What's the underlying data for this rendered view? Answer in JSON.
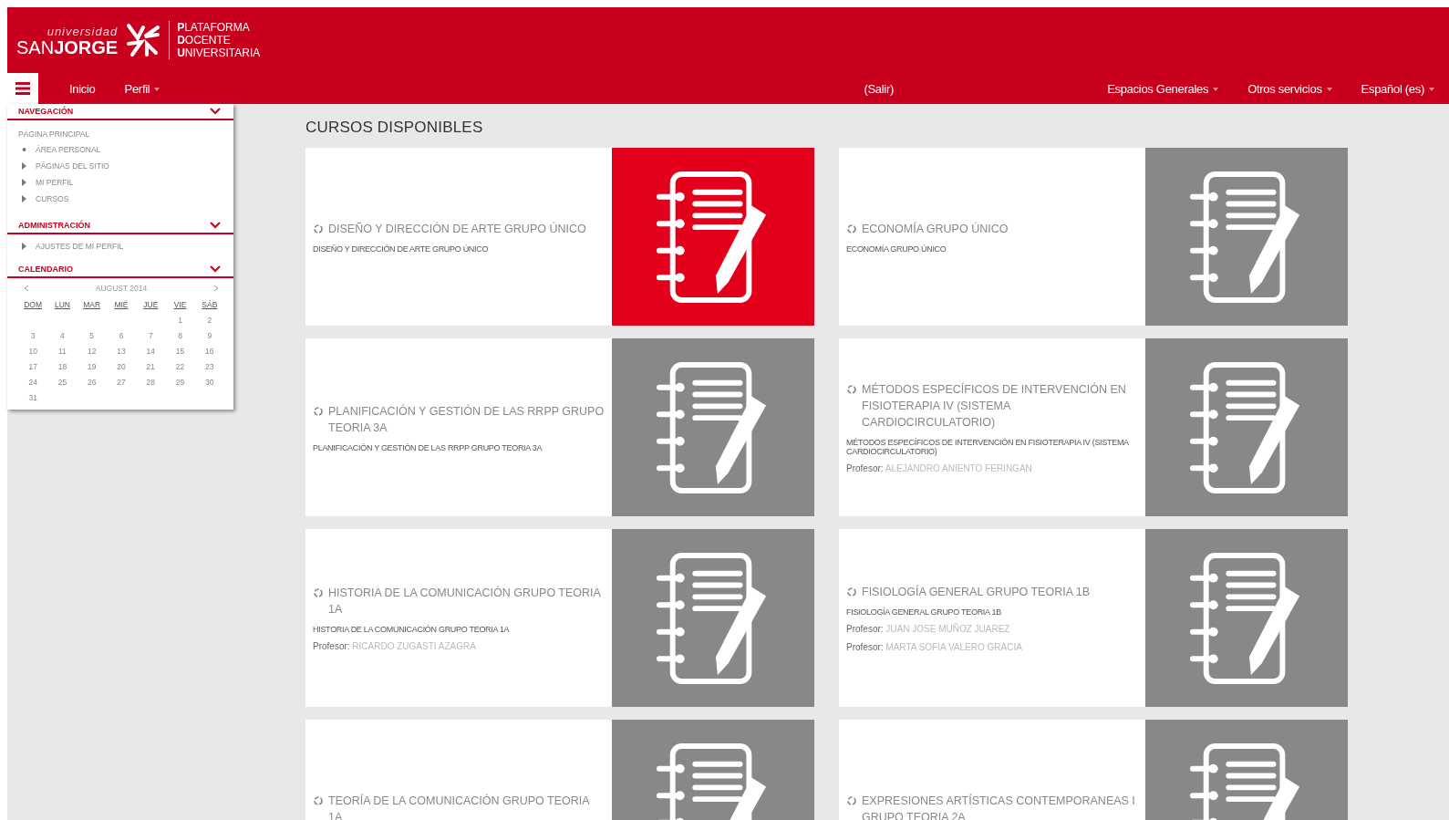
{
  "logo": {
    "top": "universidad",
    "name": "SAN**JORGE**",
    "platform": [
      "**P**LATAFORMA",
      "**D**OCENTE",
      "**U**NIVERSITARIA"
    ]
  },
  "navbar": {
    "left": [
      {
        "label": "Inicio",
        "dropdown": false
      },
      {
        "label": "Perfil",
        "dropdown": true
      }
    ],
    "logout": "(Salir)",
    "right": [
      {
        "label": "Espacios Generales",
        "dropdown": true
      },
      {
        "label": "Otros servicios",
        "dropdown": true
      },
      {
        "label": "Español (es)",
        "dropdown": true
      }
    ]
  },
  "sidebar": {
    "blocks": [
      {
        "title": "NAVEGACIÓN",
        "expanded": true,
        "items": [
          {
            "label": "PÁGINA PRINCIPAL",
            "children": [
              {
                "label": "ÁREA PERSONAL",
                "expandable": false
              },
              {
                "label": "PÁGINAS DEL SITIO",
                "expandable": true
              },
              {
                "label": "MI PERFIL",
                "expandable": true
              },
              {
                "label": "CURSOS",
                "expandable": true
              }
            ]
          }
        ]
      },
      {
        "title": "ADMINISTRACIÓN",
        "expanded": true,
        "items": [
          {
            "label": "AJUSTES DE MI PERFIL",
            "expandable": true
          }
        ]
      },
      {
        "title": "CALENDARIO",
        "expanded": true,
        "calendar": {
          "month": "AUGUST 2014",
          "weekdays": [
            "DOM",
            "LUN",
            "MAR",
            "MIÉ",
            "JUE",
            "VIE",
            "SÁB"
          ],
          "weeks": [
            {
              "kind": "first",
              "days": [
                "1",
                "2"
              ]
            },
            {
              "kind": "full",
              "days": [
                "3",
                "4",
                "5",
                "6",
                "7",
                "8",
                "9"
              ]
            },
            {
              "kind": "full",
              "days": [
                "10",
                "11",
                "12",
                "13",
                "14",
                "15",
                "16"
              ]
            },
            {
              "kind": "full",
              "days": [
                "17",
                "18",
                "19",
                "20",
                "21",
                "22",
                "23"
              ]
            },
            {
              "kind": "full",
              "days": [
                "24",
                "25",
                "26",
                "27",
                "28",
                "29",
                "30"
              ]
            },
            {
              "kind": "last",
              "days": [
                "31"
              ]
            }
          ]
        }
      }
    ]
  },
  "main": {
    "heading": "CURSOS DISPONIBLES",
    "courses": [
      {
        "title": "DISEÑO Y DIRECCIÓN DE ARTE GRUPO ÚNICO",
        "summary": "DISEÑO Y DIRECCIÓN DE ARTE GRUPO ÚNICO",
        "highlighted": true
      },
      {
        "title": "ECONOMÍA GRUPO ÚNICO",
        "summary": "ECONOMÍA GRUPO ÚNICO",
        "highlighted": false
      },
      {
        "title": "PLANIFICACIÓN Y GESTIÓN DE LAS RRPP GRUPO TEORIA 3A",
        "summary": "PLANIFICACIÓN Y GESTIÓN DE LAS RRPP GRUPO TEORIA 3A",
        "highlighted": false
      },
      {
        "title": "MÉTODOS ESPECÍFICOS DE INTERVENCIÓN EN FISIOTERAPIA IV (SISTEMA CARDIOCIRCULATORIO)",
        "summary": "MÉTODOS ESPECÍFICOS DE INTERVENCIÓN EN FISIOTERAPIA IV (SISTEMA CARDIOCIRCULATORIO)",
        "teachers": [
          {
            "role": "Profesor:",
            "name": "ALEJANDRO ANIENTO FERINGAN"
          }
        ],
        "highlighted": false
      },
      {
        "title": "HISTORIA DE LA COMUNICACIÓN GRUPO TEORIA 1A",
        "summary": "HISTORIA DE LA COMUNICACIÓN GRUPO TEORIA 1A",
        "teachers": [
          {
            "role": "Profesor:",
            "name": "RICARDO ZUGASTI AZAGRA"
          }
        ],
        "highlighted": false
      },
      {
        "title": "FISIOLOGÍA GENERAL GRUPO TEORIA 1B",
        "summary": "FISIOLOGÍA GENERAL GRUPO TEORIA 1B",
        "teachers": [
          {
            "role": "Profesor:",
            "name": "JUAN JOSE MUÑOZ JUAREZ"
          },
          {
            "role": "Profesor:",
            "name": "MARTA SOFIA VALERO GRACIA"
          }
        ],
        "highlighted": false
      },
      {
        "title": "TEORÍA DE LA COMUNICACIÓN GRUPO TEORIA 1A",
        "highlighted": false
      },
      {
        "title": "EXPRESIONES ARTÍSTICAS CONTEMPORANEAS I GRUPO TEORIA 2A",
        "highlighted": false
      }
    ]
  }
}
